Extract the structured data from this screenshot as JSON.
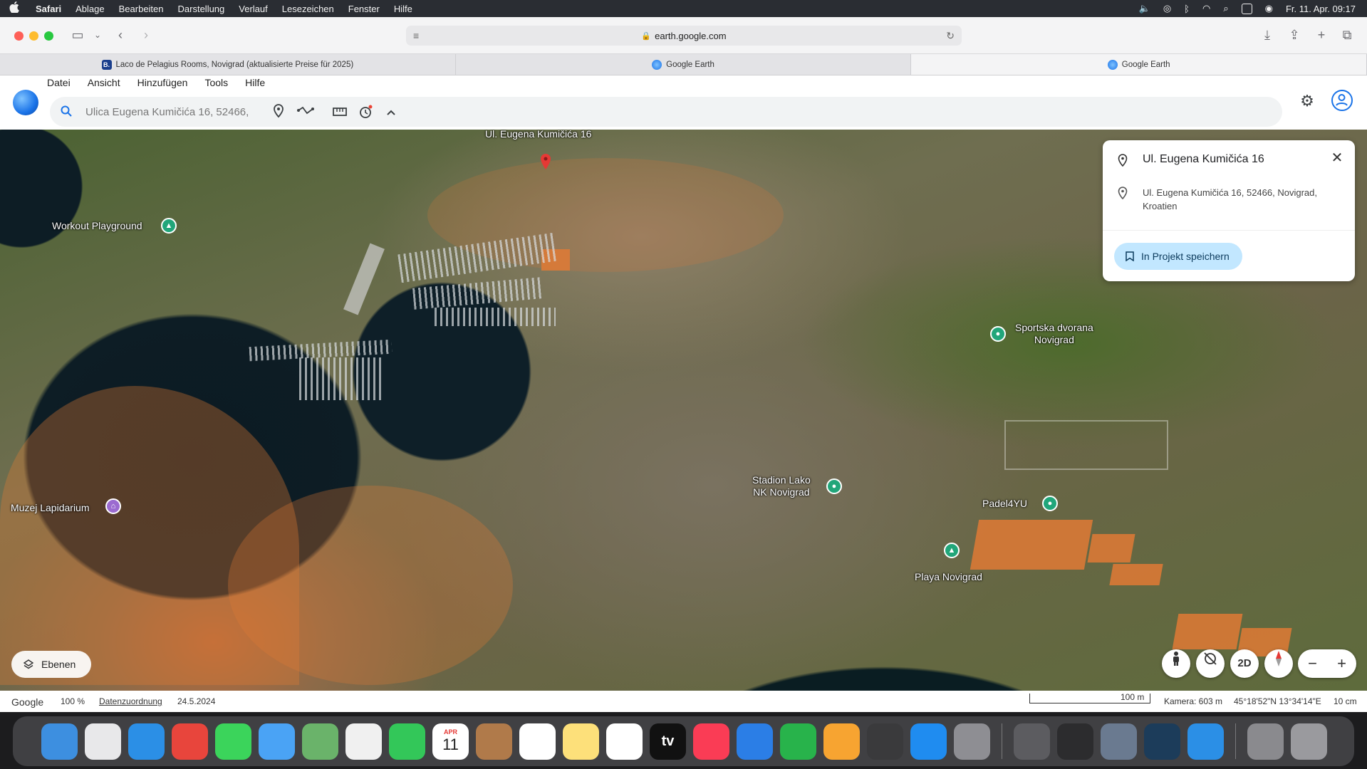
{
  "menubar": {
    "apple": "",
    "items": [
      "Safari",
      "Ablage",
      "Bearbeiten",
      "Darstellung",
      "Verlauf",
      "Lesezeichen",
      "Fenster",
      "Hilfe"
    ],
    "datetime": "Fr. 11. Apr.  09:17"
  },
  "browser": {
    "url": "earth.google.com",
    "tabs": [
      {
        "title": "Laco de Pelagius Rooms, Novigrad (aktualisierte Preise für 2025)",
        "favicon_color": "#1a3e8c",
        "favicon_text": "B."
      },
      {
        "title": "Google Earth",
        "favicon_color": "#4a90e2",
        "favicon_text": ""
      },
      {
        "title": "Google Earth",
        "favicon_color": "#4a90e2",
        "favicon_text": ""
      }
    ]
  },
  "earth": {
    "menu": [
      "Datei",
      "Ansicht",
      "Hinzufügen",
      "Tools",
      "Hilfe"
    ],
    "search_value": "Ulica Eugena Kumičića 16, 52466,",
    "accent": "#1a73e8"
  },
  "map": {
    "top_label": "Ul. Eugena Kumičića 16",
    "labels": {
      "workout": "Workout Playground",
      "sportska": "Sportska dvorana\nNovigrad",
      "stadion": "Stadion Lako\nNK Novigrad",
      "padel": "Padel4YU",
      "playa": "Playa Novigrad",
      "muzej": "Muzej Lapidarium"
    },
    "layers_label": "Ebenen",
    "btn_2d": "2D"
  },
  "infocard": {
    "title": "Ul. Eugena Kumičića 16",
    "address": "Ul. Eugena Kumičića 16, 52466, Novigrad, Kroatien",
    "save_label": "In Projekt speichern"
  },
  "statusbar": {
    "brand": "Google",
    "zoom": "100 %",
    "attribution": "Datenzuordnung",
    "date": "24.5.2024",
    "scale": "100 m",
    "camera": "Kamera: 603 m",
    "coords": "45°18'52\"N 13°34'14\"E",
    "elevation": "10 cm"
  },
  "dock": {
    "apps": [
      {
        "name": "finder",
        "color": "#3d8fe0",
        "text": ""
      },
      {
        "name": "launchpad",
        "color": "#e8e8ea",
        "text": ""
      },
      {
        "name": "safari",
        "color": "#2b8fe6",
        "text": ""
      },
      {
        "name": "chrome",
        "color": "#e8453c",
        "text": ""
      },
      {
        "name": "messages",
        "color": "#3bd45b",
        "text": ""
      },
      {
        "name": "mail",
        "color": "#4aa3f5",
        "text": ""
      },
      {
        "name": "maps",
        "color": "#6ab36a",
        "text": ""
      },
      {
        "name": "photos",
        "color": "#f0f0f0",
        "text": ""
      },
      {
        "name": "facetime",
        "color": "#33c759",
        "text": ""
      },
      {
        "name": "calendar",
        "color": "#ffffff",
        "text": "11",
        "month": "APR"
      },
      {
        "name": "contacts",
        "color": "#b07a4a",
        "text": ""
      },
      {
        "name": "reminders",
        "color": "#ffffff",
        "text": ""
      },
      {
        "name": "notes",
        "color": "#fde07a",
        "text": ""
      },
      {
        "name": "freeform",
        "color": "#ffffff",
        "text": ""
      },
      {
        "name": "tv",
        "color": "#111111",
        "text": "tv"
      },
      {
        "name": "music",
        "color": "#fa3c55",
        "text": ""
      },
      {
        "name": "keynote",
        "color": "#2b7ee6",
        "text": ""
      },
      {
        "name": "numbers",
        "color": "#28b34b",
        "text": ""
      },
      {
        "name": "pages",
        "color": "#f7a431",
        "text": ""
      },
      {
        "name": "calculator",
        "color": "#3a3a3c",
        "text": ""
      },
      {
        "name": "app-store",
        "color": "#1f8cf0",
        "text": ""
      },
      {
        "name": "system-settings",
        "color": "#8e8e93",
        "text": ""
      },
      {
        "name": "preview",
        "color": "#5c5c60",
        "text": ""
      },
      {
        "name": "screenshot",
        "color": "#2c2c2e",
        "text": ""
      },
      {
        "name": "image-capture",
        "color": "#6a7a90",
        "text": ""
      },
      {
        "name": "quicktime",
        "color": "#1c3c5a",
        "text": ""
      },
      {
        "name": "safari-2",
        "color": "#2b8fe6",
        "text": ""
      },
      {
        "name": "archive",
        "color": "#8a8a8e",
        "text": ""
      },
      {
        "name": "trash",
        "color": "#9a9a9e",
        "text": ""
      }
    ]
  }
}
